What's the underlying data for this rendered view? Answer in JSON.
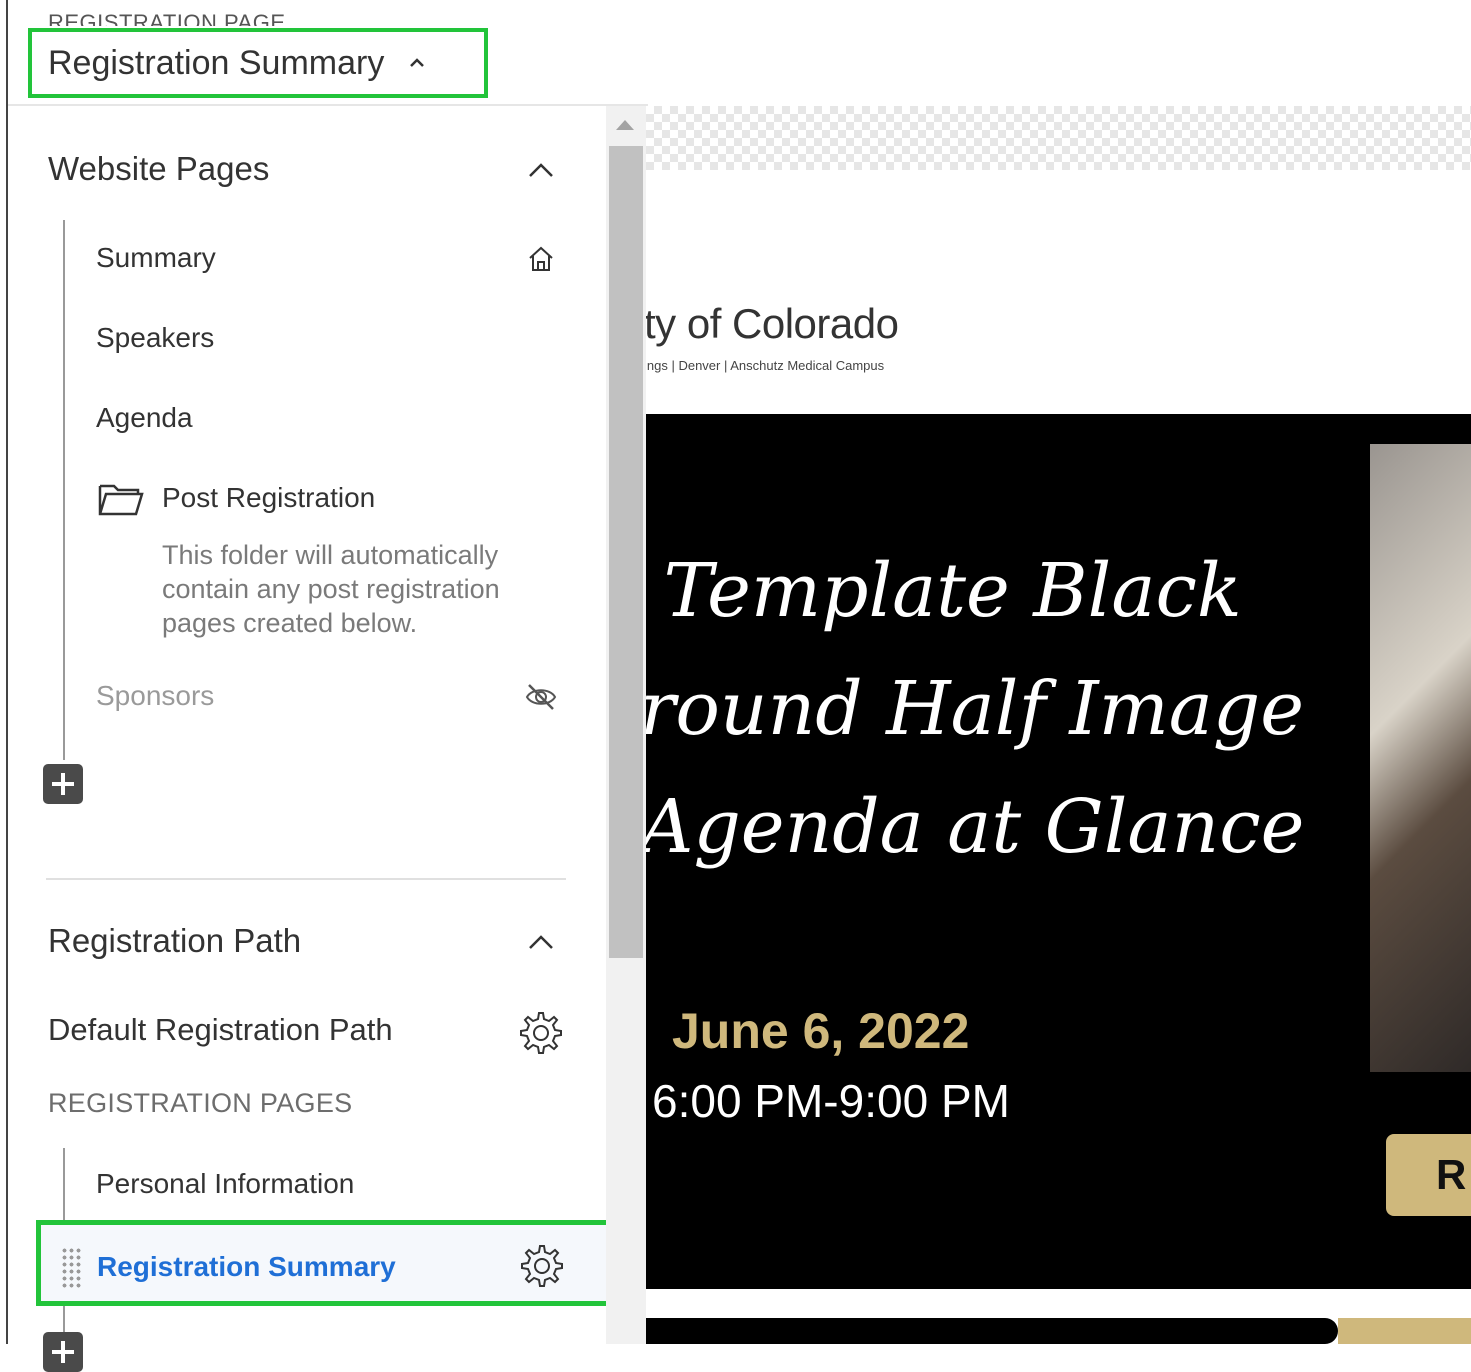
{
  "header": {
    "small_label": "REGISTRATION PAGE",
    "dropdown_title": "Registration Summary"
  },
  "website_pages": {
    "title": "Website Pages",
    "items": [
      {
        "label": "Summary",
        "icon": "home-icon"
      },
      {
        "label": "Speakers"
      },
      {
        "label": "Agenda"
      },
      {
        "label": "Post Registration",
        "icon": "folder-icon",
        "note": "This folder will automatically contain any post registration pages created below."
      },
      {
        "label": "Sponsors",
        "icon": "eye-off-icon",
        "hidden": true
      }
    ]
  },
  "registration_path": {
    "title": "Registration Path",
    "default_path_label": "Default Registration Path",
    "pages_label": "REGISTRATION PAGES",
    "pages": [
      {
        "label": "Personal Information"
      },
      {
        "label": "Registration Summary",
        "selected": true,
        "icon": "gear-icon"
      }
    ]
  },
  "preview": {
    "org_name": "ty of Colorado",
    "org_sub": "ings | Denver | Anschutz Medical Campus",
    "hero_title": " Template Black\nround Half Image\nAgenda at Glance",
    "hero_date": "June 6, 2022",
    "hero_time": "6:00 PM-9:00 PM",
    "button_label": "R"
  },
  "colors": {
    "highlight_border": "#22c43a",
    "selected_text": "#1f6fd6",
    "gold": "#cfb87c"
  }
}
